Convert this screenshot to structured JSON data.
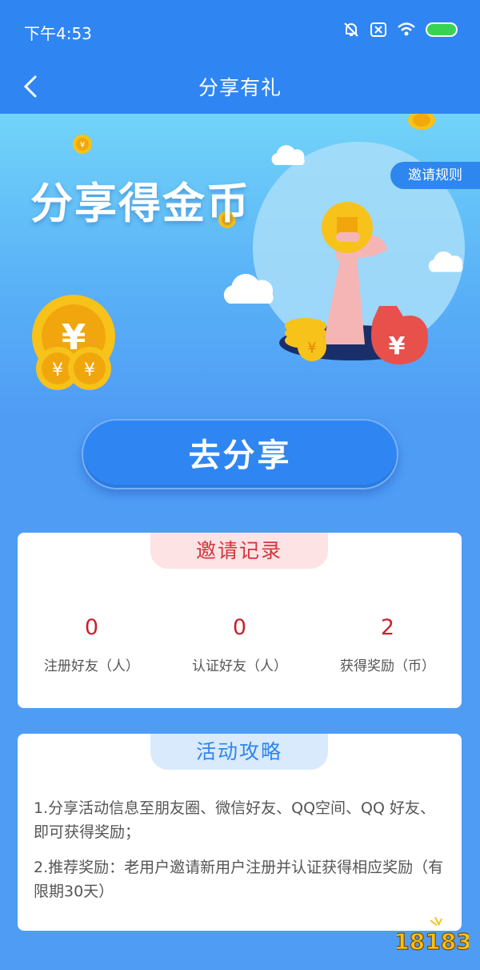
{
  "status": {
    "time": "下午4:53"
  },
  "nav": {
    "title": "分享有礼"
  },
  "hero": {
    "title": "分享得金币",
    "rules_label": "邀请规则"
  },
  "share_button_label": "去分享",
  "invite_record": {
    "title": "邀请记录",
    "stats": [
      {
        "value": "0",
        "label": "注册好友（人）"
      },
      {
        "value": "0",
        "label": "认证好友（人）"
      },
      {
        "value": "2",
        "label": "获得奖励（币）"
      }
    ]
  },
  "guide": {
    "title": "活动攻略",
    "items": [
      "1.分享活动信息至朋友圈、微信好友、QQ空间、QQ 好友、即可获得奖励；",
      "2.推荐奖励：老用户邀请新用户注册并认证获得相应奖励（有限期30天）"
    ]
  },
  "watermark": "18183",
  "colors": {
    "primary": "#2f86f2",
    "background": "#4f9cf5",
    "accent_red": "#c9222f",
    "gold": "#f7c21a"
  }
}
